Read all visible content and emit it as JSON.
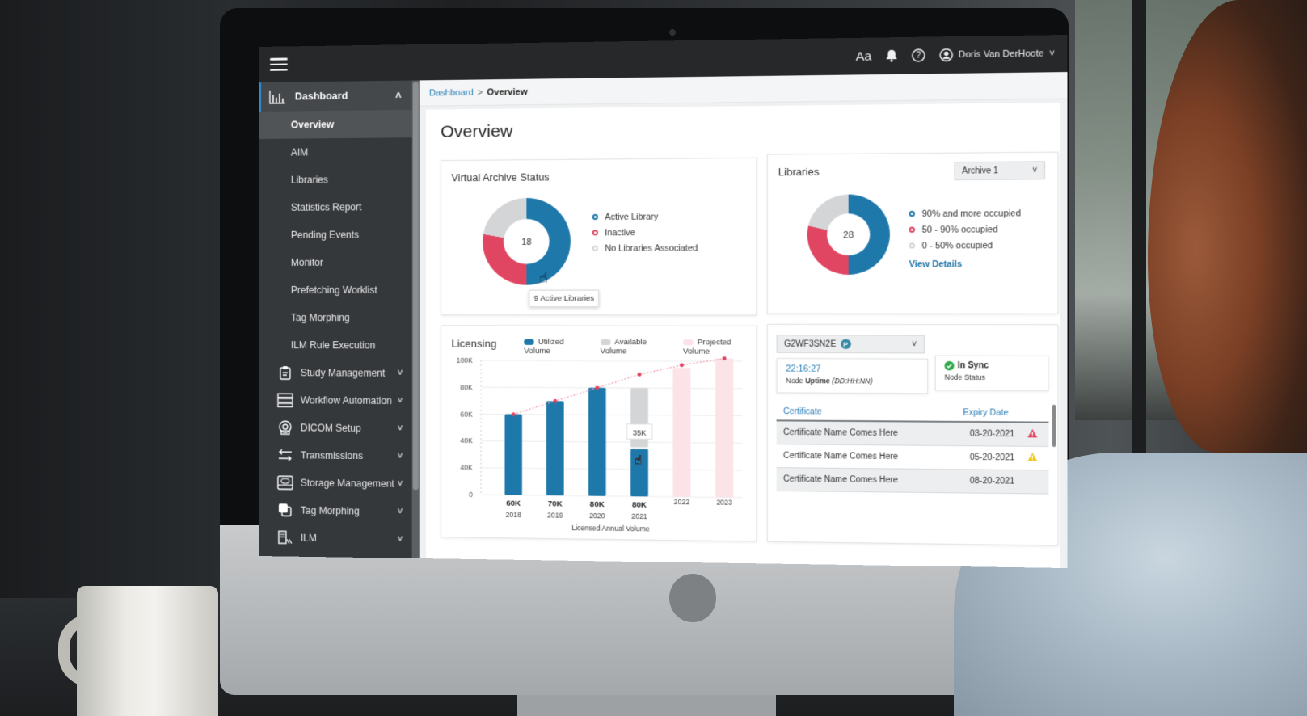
{
  "topbar": {
    "menu_icon": "hamburger-menu-icon",
    "font_size_label": "Aa",
    "notifications_icon": "bell-icon",
    "help_icon": "question-circle-icon",
    "user_icon": "user-circle-icon",
    "user_name": "Doris Van DerHoote"
  },
  "sidebar": {
    "dashboard": {
      "label": "Dashboard",
      "icon": "bar-chart-icon",
      "expanded": true
    },
    "dashboard_items": [
      {
        "label": "Overview",
        "active": true
      },
      {
        "label": "AIM"
      },
      {
        "label": "Libraries"
      },
      {
        "label": "Statistics Report"
      },
      {
        "label": "Pending Events"
      },
      {
        "label": "Monitor"
      },
      {
        "label": "Prefetching Worklist"
      },
      {
        "label": "Tag Morphing"
      },
      {
        "label": "ILM Rule Execution"
      }
    ],
    "sections": [
      {
        "label": "Study Management",
        "icon": "clipboard-icon"
      },
      {
        "label": "Workflow Automation",
        "icon": "workflow-icon"
      },
      {
        "label": "DICOM Setup",
        "icon": "scanner-icon"
      },
      {
        "label": "Transmissions",
        "icon": "arrows-exchange-icon"
      },
      {
        "label": "Storage Management",
        "icon": "storage-drive-icon"
      },
      {
        "label": "Tag Morphing",
        "icon": "layers-icon"
      },
      {
        "label": "ILM",
        "icon": "ilm-icon"
      }
    ]
  },
  "breadcrumb": {
    "parent": "Dashboard",
    "separator": ">",
    "current": "Overview"
  },
  "page_title": "Overview",
  "virtual_archive": {
    "title": "Virtual Archive Status",
    "total": "18",
    "tooltip": "9 Active Libraries",
    "legend": [
      {
        "label": "Active Library",
        "color": "#1f78aa"
      },
      {
        "label": "Inactive",
        "color": "#e04562"
      },
      {
        "label": "No Libraries Associated",
        "color": "#d3d5d7"
      }
    ]
  },
  "libraries": {
    "title": "Libraries",
    "select_value": "Archive 1",
    "total": "28",
    "view_details": "View Details",
    "legend": [
      {
        "label": "90% and more occupied",
        "color": "#1f78aa"
      },
      {
        "label": "50 - 90% occupied",
        "color": "#e04562"
      },
      {
        "label": "0 - 50% occupied",
        "color": "#d3d5d7"
      }
    ]
  },
  "licensing": {
    "title": "Licensing",
    "tooltip": "35K"
  },
  "node": {
    "select_value": "G2WF3SN2E",
    "badge": "P",
    "uptime_value": "22:16:27",
    "uptime_label_prefix": "Node ",
    "uptime_label_bold": "Uptime",
    "uptime_label_suffix": " (DD:HH:NN)",
    "sync_value": "In Sync",
    "sync_label": "Node Status",
    "table_headers": {
      "certificate": "Certificate",
      "expiry": "Expiry Date"
    },
    "certificates": [
      {
        "name": "Certificate Name Comes Here",
        "expiry": "03-20-2021",
        "warning": "error"
      },
      {
        "name": "Certificate Name Comes Here",
        "expiry": "05-20-2021",
        "warning": "warning"
      },
      {
        "name": "Certificate Name Comes Here",
        "expiry": "08-20-2021",
        "warning": "none"
      }
    ]
  },
  "colors": {
    "primary": "#1f78aa",
    "danger": "#e04562",
    "neutral": "#d3d5d7",
    "projected": "#fbe3e8",
    "warning": "#f0c419",
    "success": "#2ea84a"
  },
  "chart_data": [
    {
      "type": "pie",
      "title": "Virtual Archive Status",
      "center_label": "18",
      "categories": [
        "Active Library",
        "Inactive",
        "No Libraries Associated"
      ],
      "values": [
        9,
        5,
        4
      ]
    },
    {
      "type": "pie",
      "title": "Libraries",
      "center_label": "28",
      "categories": [
        "90% and more occupied",
        "50 - 90% occupied",
        "0 - 50% occupied"
      ],
      "values": [
        14,
        8,
        6
      ]
    },
    {
      "type": "bar",
      "title": "Licensing",
      "xlabel": "Licensed Annual Volume",
      "ylabel": "",
      "categories": [
        "2018",
        "2019",
        "2020",
        "2021",
        "2022",
        "2023"
      ],
      "bar_labels": [
        "60K",
        "70K",
        "80K",
        "80K",
        "",
        ""
      ],
      "y_tick_labels": [
        "0",
        "40K",
        "40K",
        "60K",
        "80K",
        "100K"
      ],
      "ylim": [
        0,
        100000
      ],
      "legend": [
        "Utilized Volume",
        "Available Volume",
        "Projected Volume"
      ],
      "legend_position": "top",
      "series": [
        {
          "name": "Utilized Volume",
          "values": [
            60000,
            70000,
            80000,
            35000,
            null,
            null
          ]
        },
        {
          "name": "Available Volume",
          "values": [
            null,
            null,
            null,
            45000,
            null,
            null
          ]
        },
        {
          "name": "Projected Volume",
          "values": [
            null,
            null,
            null,
            null,
            95000,
            102000
          ]
        },
        {
          "name": "Licensed Trend",
          "style": "dotted-line",
          "values": [
            60000,
            70000,
            80000,
            90000,
            97000,
            102000
          ]
        }
      ],
      "highlight": {
        "category": "2021",
        "series": "Utilized Volume",
        "tooltip": "35K"
      },
      "grid": true
    }
  ]
}
